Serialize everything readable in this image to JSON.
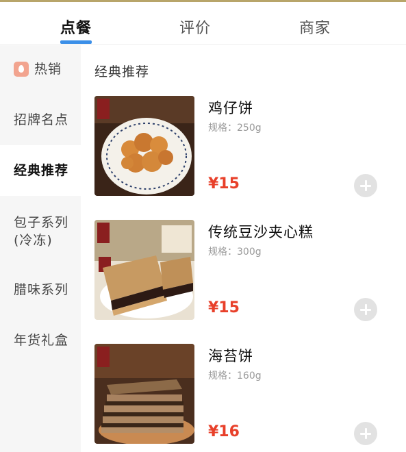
{
  "tabs": [
    {
      "label": "点餐",
      "active": true
    },
    {
      "label": "评价",
      "active": false
    },
    {
      "label": "商家",
      "active": false
    }
  ],
  "sidebar": {
    "items": [
      {
        "label": "热销",
        "icon": "hot-flame-icon",
        "active": false
      },
      {
        "label": "招牌名点",
        "active": false
      },
      {
        "label": "经典推荐",
        "active": true
      },
      {
        "label": "包子系列(冷冻)",
        "line1": "包子系列",
        "line2": "(冷冻)",
        "active": false
      },
      {
        "label": "腊味系列",
        "active": false
      },
      {
        "label": "年货礼盒",
        "active": false
      }
    ]
  },
  "section": {
    "title": "经典推荐"
  },
  "products": [
    {
      "name": "鸡仔饼",
      "spec": "规格：250g",
      "price": "¥15",
      "image": "chicken-cookie-photo"
    },
    {
      "name": "传统豆沙夹心糕",
      "spec": "规格：300g",
      "price": "¥15",
      "image": "bean-paste-cake-photo"
    },
    {
      "name": "海苔饼",
      "spec": "规格：160g",
      "price": "¥16",
      "image": "seaweed-biscuit-photo"
    }
  ],
  "colors": {
    "accent": "#3b8fe8",
    "price": "#e8402a",
    "sidebar_bg": "#f6f6f6",
    "hot_icon": "#f2a48f",
    "top_border": "#b8a56a"
  }
}
